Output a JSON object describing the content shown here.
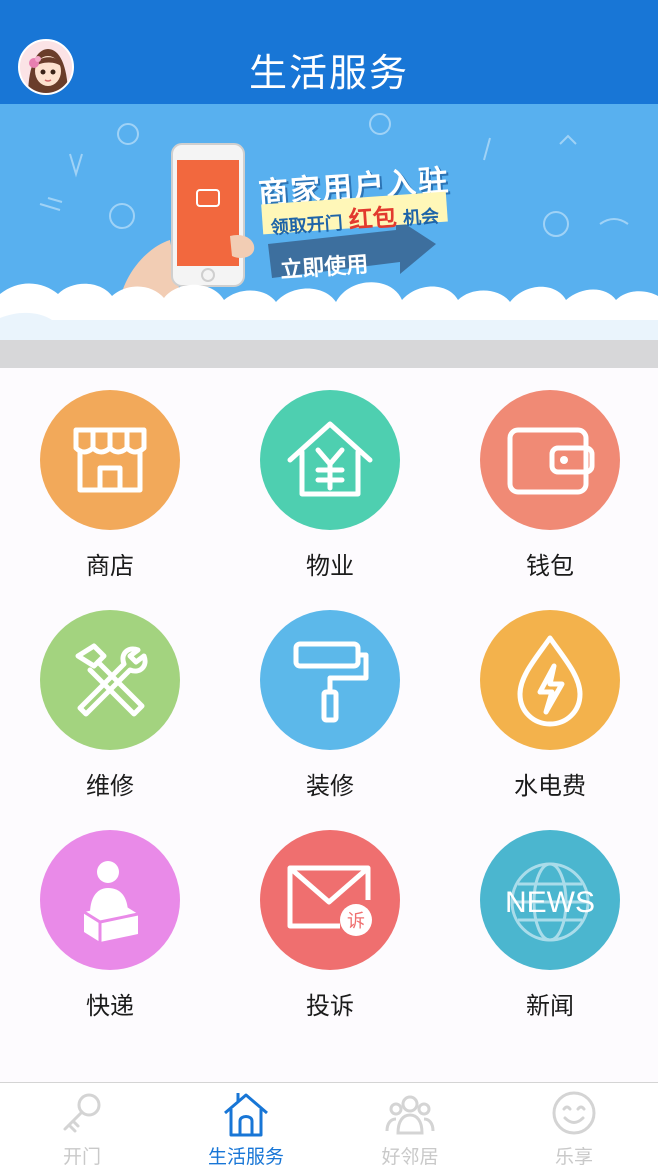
{
  "header": {
    "title": "生活服务"
  },
  "banner": {
    "line1": "商家用户入驻",
    "line2_prefix": "领取开门",
    "line2_highlight": "红包",
    "line2_suffix": "机会",
    "button": "立即使用"
  },
  "services": [
    {
      "label": "商店",
      "icon": "store-icon",
      "color": "#f2a95a"
    },
    {
      "label": "物业",
      "icon": "property-house-icon",
      "color": "#4ecfb0"
    },
    {
      "label": "钱包",
      "icon": "wallet-icon",
      "color": "#f08a75"
    },
    {
      "label": "维修",
      "icon": "repair-tools-icon",
      "color": "#a3d37f"
    },
    {
      "label": "装修",
      "icon": "paint-roller-icon",
      "color": "#5cb8ea"
    },
    {
      "label": "水电费",
      "icon": "utility-drop-icon",
      "color": "#f3b24c"
    },
    {
      "label": "快递",
      "icon": "courier-package-icon",
      "color": "#e98ae8"
    },
    {
      "label": "投诉",
      "icon": "complaint-mail-icon",
      "color": "#ef6f6f"
    },
    {
      "label": "新闻",
      "icon": "news-globe-icon",
      "color": "#4bb6cf"
    }
  ],
  "tabbar": {
    "tabs": [
      {
        "label": "开门",
        "icon": "key-icon",
        "active": false
      },
      {
        "label": "生活服务",
        "icon": "home-icon",
        "active": true
      },
      {
        "label": "好邻居",
        "icon": "neighbors-icon",
        "active": false
      },
      {
        "label": "乐享",
        "icon": "smiley-icon",
        "active": false
      }
    ]
  },
  "colors": {
    "header": "#1876d6",
    "active_tab": "#1876d6",
    "inactive_tab": "#c9c9c9"
  }
}
